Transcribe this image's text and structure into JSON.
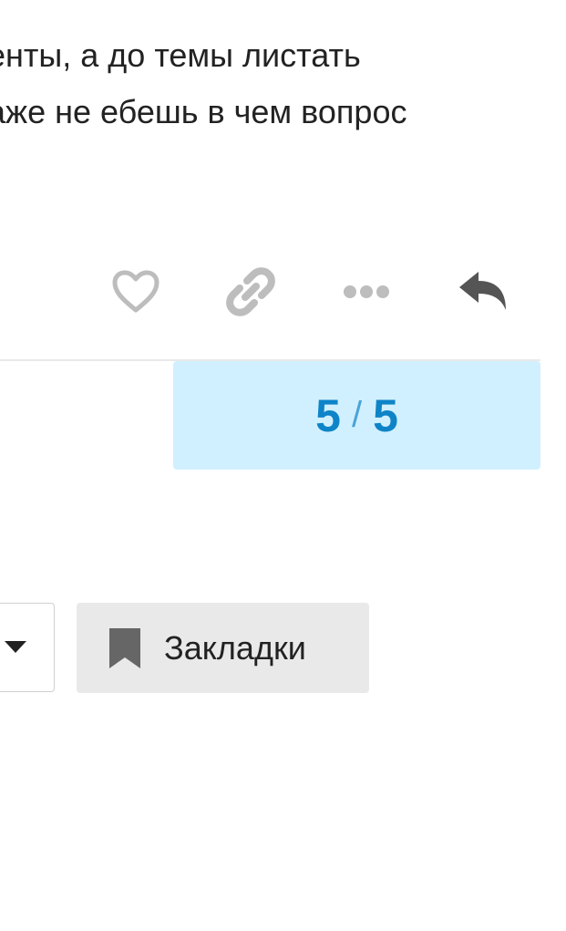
{
  "post": {
    "lines": [
      "енты, а до темы листать",
      "аже не ебешь в чем вопрос"
    ]
  },
  "actions": {
    "like_icon": "heart-outline-icon",
    "link_icon": "link-icon",
    "more_icon": "ellipsis-icon",
    "reply_icon": "reply-arrow-icon"
  },
  "progress": {
    "current": "5",
    "separator": "/",
    "total": "5"
  },
  "footer": {
    "dropdown_icon": "caret-down-icon",
    "bookmark_icon": "bookmark-icon",
    "bookmark_label": "Закладки"
  },
  "colors": {
    "progress_bg": "#d1f0ff",
    "progress_text": "#0e84c8",
    "icon_light": "#bdbdbd",
    "icon_dark": "#555555",
    "button_bg": "#e9e9e9"
  }
}
